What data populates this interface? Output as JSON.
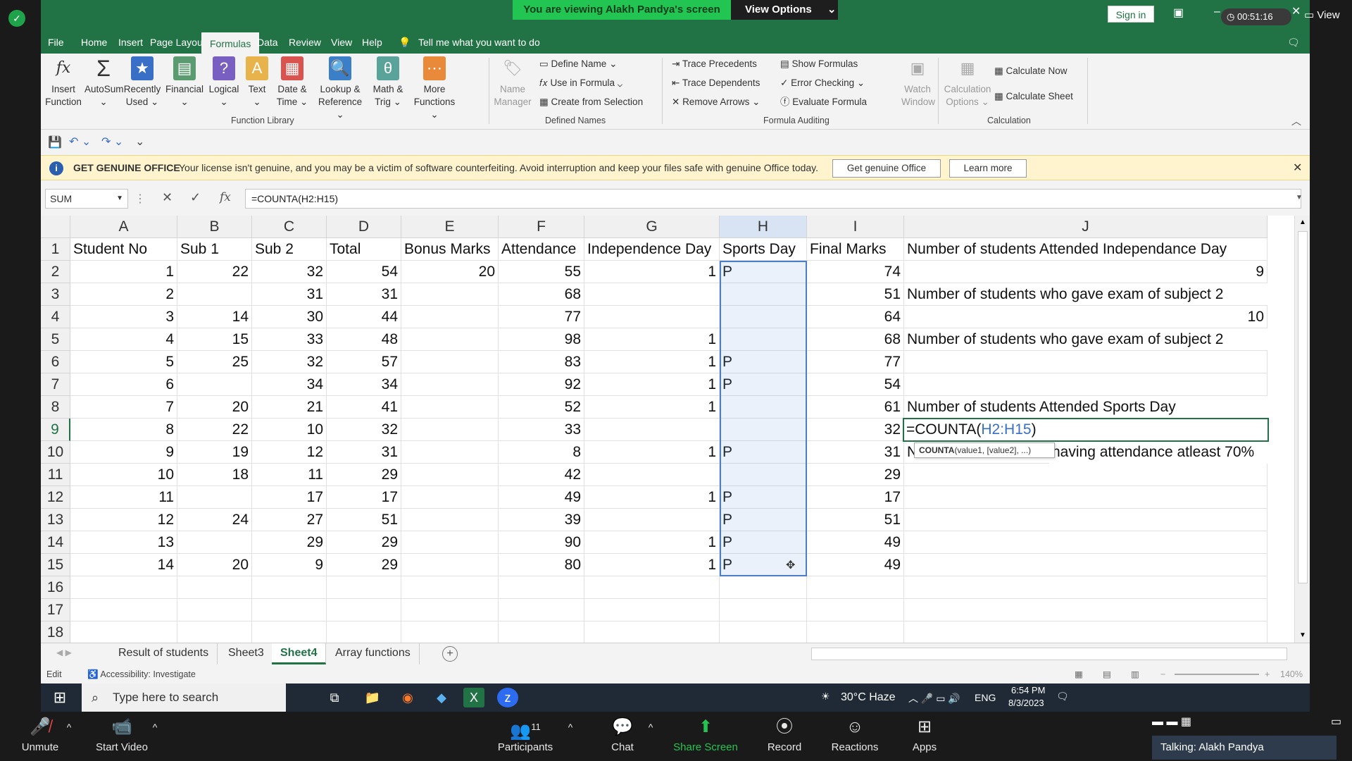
{
  "zoom": {
    "viewing_banner": "You are viewing Alakh Pandya's screen",
    "view_options": "View Options",
    "timer": "00:51:16",
    "view_btn": "View",
    "controls": [
      "Unmute",
      "Start Video",
      "Participants",
      "Chat",
      "Share Screen",
      "Record",
      "Reactions",
      "Apps"
    ],
    "participants_count": "11",
    "talking": "Talking: Alakh Pandya",
    "share_color": "#23c552"
  },
  "excel": {
    "sign_in": "Sign in",
    "menu": [
      "File",
      "Home",
      "Insert",
      "Page Layout",
      "Formulas",
      "Data",
      "Review",
      "View",
      "Help"
    ],
    "tell_me": "Tell me what you want to do",
    "ribbon": {
      "insert_function": [
        "Insert",
        "Function"
      ],
      "autosum": [
        "AutoSum",
        ""
      ],
      "recently_used": [
        "Recently",
        "Used"
      ],
      "financial": [
        "Financial",
        ""
      ],
      "logical": [
        "Logical",
        ""
      ],
      "text": [
        "Text",
        ""
      ],
      "date_time": [
        "Date &",
        "Time"
      ],
      "lookup": [
        "Lookup &",
        "Reference"
      ],
      "math": [
        "Math &",
        "Trig"
      ],
      "more": [
        "More",
        "Functions"
      ],
      "function_library": "Function Library",
      "name_manager": [
        "Name",
        "Manager"
      ],
      "define_name": "Define Name",
      "use_in_formula": "Use in Formula",
      "create_from_selection": "Create from Selection",
      "defined_names": "Defined Names",
      "trace_precedents": "Trace Precedents",
      "trace_dependents": "Trace Dependents",
      "remove_arrows": "Remove Arrows",
      "show_formulas": "Show Formulas",
      "error_checking": "Error Checking",
      "evaluate_formula": "Evaluate Formula",
      "watch_window": [
        "Watch",
        "Window"
      ],
      "formula_auditing": "Formula Auditing",
      "calc_options": [
        "Calculation",
        "Options"
      ],
      "calculate_now": "Calculate Now",
      "calculate_sheet": "Calculate Sheet",
      "calculation": "Calculation"
    },
    "license": {
      "title": "GET GENUINE OFFICE",
      "message": "Your license isn't genuine, and you may be a victim of software counterfeiting. Avoid interruption and keep your files safe with genuine Office today.",
      "get_btn": "Get genuine Office",
      "learn_btn": "Learn more"
    },
    "name_box": "SUM",
    "formula": "=COUNTA(H2:H15)",
    "columns": [
      "A",
      "B",
      "C",
      "D",
      "E",
      "F",
      "G",
      "H",
      "I",
      "J"
    ],
    "rows": [
      [
        "Student No",
        "Sub 1",
        "Sub 2",
        "Total",
        "Bonus Marks",
        "Attendance",
        "Independence Day",
        "Sports Day",
        "Final Marks",
        "Number of students Attended Independance Day"
      ],
      [
        "1",
        "22",
        "32",
        "54",
        "20",
        "55",
        "1",
        "P",
        "74",
        "9"
      ],
      [
        "2",
        "",
        "31",
        "31",
        "",
        "68",
        "",
        "",
        "51",
        "Number of students who gave exam of subject 2"
      ],
      [
        "3",
        "14",
        "30",
        "44",
        "",
        "77",
        "",
        "",
        "64",
        "10"
      ],
      [
        "4",
        "15",
        "33",
        "48",
        "",
        "98",
        "1",
        "",
        "68",
        "Number of students who gave exam of subject 2"
      ],
      [
        "5",
        "25",
        "32",
        "57",
        "",
        "83",
        "1",
        "P",
        "77",
        ""
      ],
      [
        "6",
        "",
        "34",
        "34",
        "",
        "92",
        "1",
        "P",
        "54",
        ""
      ],
      [
        "7",
        "20",
        "21",
        "41",
        "",
        "52",
        "1",
        "",
        "61",
        "Number of students Attended Sports Day"
      ],
      [
        "8",
        "22",
        "10",
        "32",
        "",
        "33",
        "",
        "",
        "32",
        ""
      ],
      [
        "9",
        "19",
        "12",
        "31",
        "",
        "8",
        "1",
        "P",
        "31",
        "N"
      ],
      [
        "10",
        "18",
        "11",
        "29",
        "",
        "42",
        "",
        "",
        "29",
        ""
      ],
      [
        "11",
        "",
        "17",
        "17",
        "",
        "49",
        "1",
        "P",
        "17",
        ""
      ],
      [
        "12",
        "24",
        "27",
        "51",
        "",
        "39",
        "",
        "P",
        "51",
        ""
      ],
      [
        "13",
        "",
        "29",
        "29",
        "",
        "90",
        "1",
        "P",
        "49",
        ""
      ],
      [
        "14",
        "20",
        "9",
        "29",
        "",
        "80",
        "1",
        "P",
        "49",
        ""
      ],
      [
        "",
        "",
        "",
        "",
        "",
        "",
        "",
        "",
        "",
        ""
      ],
      [
        "",
        "",
        "",
        "",
        "",
        "",
        "",
        "",
        "",
        ""
      ],
      [
        "",
        "",
        "",
        "",
        "",
        "",
        "",
        "",
        "",
        ""
      ]
    ],
    "row_numbers": [
      "1",
      "2",
      "3",
      "4",
      "5",
      "6",
      "7",
      "8",
      "9",
      "10",
      "11",
      "12",
      "13",
      "14",
      "15",
      "16",
      "17",
      "18"
    ],
    "active_cell_formula_prefix": "=COUNTA(",
    "active_cell_formula_ref": "H2:H15",
    "active_cell_formula_suffix": ")",
    "j10_tail": "having attendance atleast 70%",
    "tooltip": "COUNTA(value1, [value2], ...)",
    "tooltip_fn": "COUNTA",
    "tooltip_args": "(value1, [value2], ...)",
    "sheets": [
      "Result of students",
      "Sheet3",
      "Sheet4",
      "Array functions"
    ],
    "status_mode": "Edit",
    "status_accessibility": "Accessibility: Investigate",
    "zoom_level": "140%",
    "accent": "#217346"
  },
  "taskbar": {
    "search": "Type here to search",
    "weather": "30°C  Haze",
    "lang": "ENG",
    "time": "6:54 PM",
    "date": "8/3/2023"
  }
}
